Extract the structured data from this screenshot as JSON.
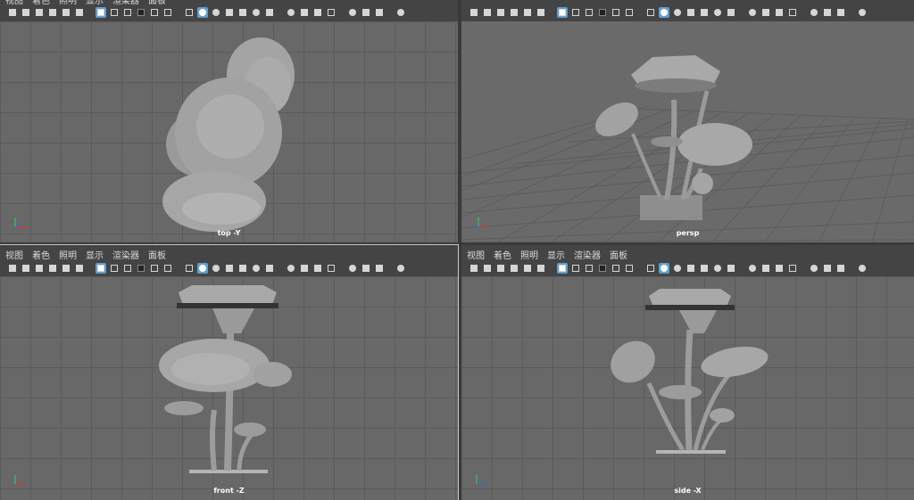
{
  "menu": [
    "视图",
    "着色",
    "照明",
    "显示",
    "渲染器",
    "面板"
  ],
  "panes": {
    "top": {
      "camera": "top -Y"
    },
    "persp": {
      "camera": "persp"
    },
    "front": {
      "camera": "front -Z"
    },
    "side": {
      "camera": "side -X"
    }
  },
  "toolbar_icons": [
    "camera-icon",
    "camera-lock-icon",
    "camera-attr-icon",
    "bookmark-icon",
    "image-plane-icon",
    "grease-pencil-icon",
    "separator",
    "grid-icon",
    "film-gate-icon",
    "resolution-gate-icon",
    "gate-mask-icon",
    "field-chart-icon",
    "safe-area-icon",
    "separator",
    "wireframe-icon",
    "smooth-shade-icon",
    "shade-wire-icon",
    "xray-icon",
    "textured-icon",
    "lights-icon",
    "shadows-icon",
    "separator",
    "ambient-occlusion-icon",
    "motion-blur-icon",
    "anti-alias-icon",
    "depth-of-field-icon",
    "separator",
    "isolate-icon",
    "xray-active-icon",
    "xray-joints-icon",
    "separator",
    "gamma-icon"
  ],
  "colors": {
    "viewport": "#686868",
    "grid": "#5b5b5b",
    "accent": "#5da0cf",
    "model": "#a6a6a6"
  }
}
